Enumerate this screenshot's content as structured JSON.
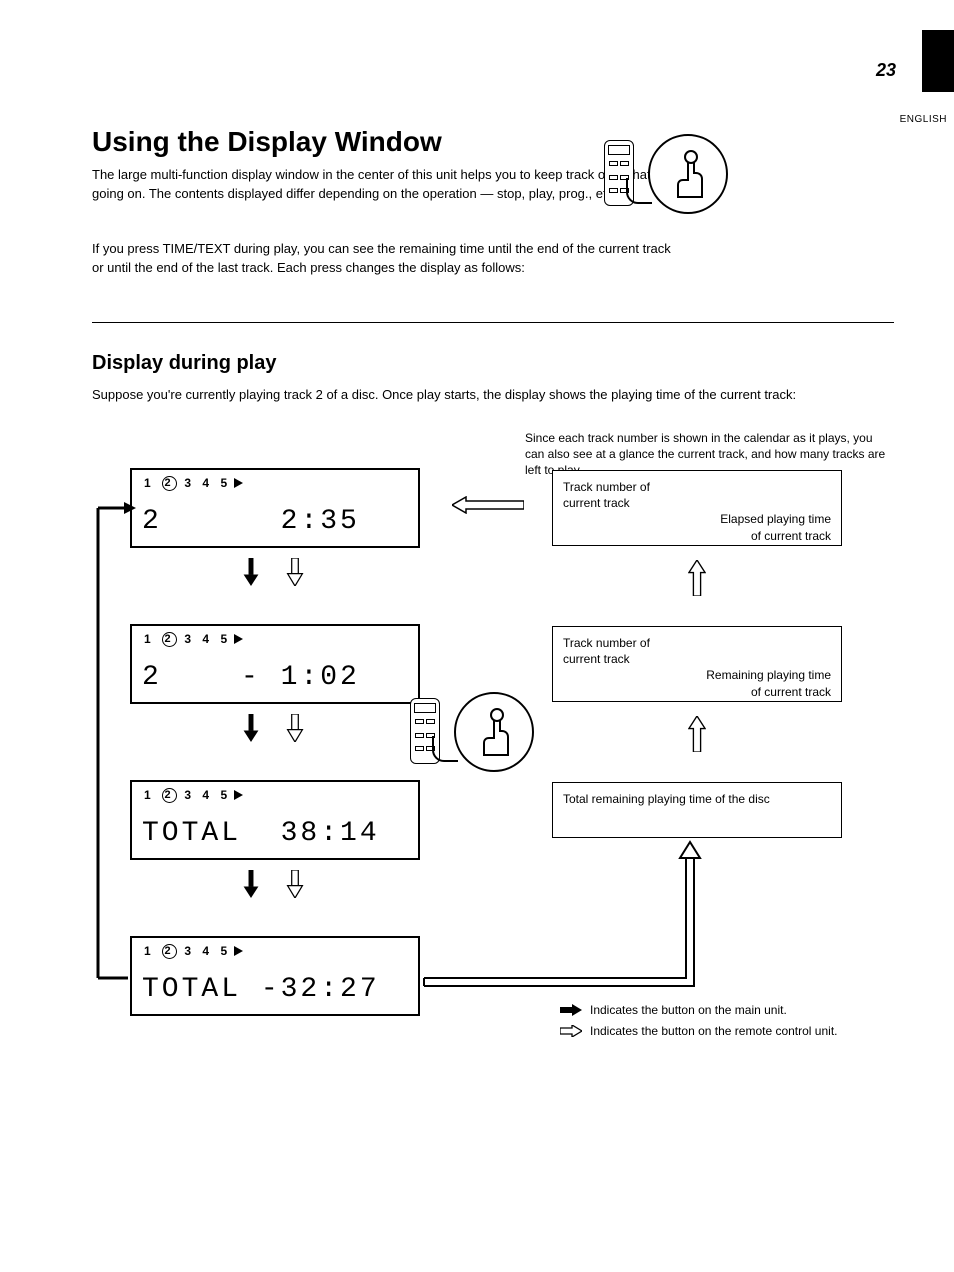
{
  "page_number": "23",
  "language_label": "ENGLISH",
  "heading1": "Using the Display Window",
  "paragraph1": "The large multi-function display window in the center of this unit helps you to keep track of all that's going on. The contents displayed differ depending on the operation — stop, play, prog., etc.",
  "paragraph2": "If you press TIME/TEXT during play, you can see the remaining time until the end of the current track or until the end of the last track. Each press changes the display as follows:",
  "heading2": "Display during play",
  "intro": "Suppose you're currently playing track 2 of a disc. Once play starts, the display shows the playing time of the current track:",
  "note_right": "Since each track number is shown in the calendar as it plays, you can also see at a glance the current track, and how many tracks are left to play.",
  "lcd_numbers": "1 2 3 4 5",
  "lcd1": {
    "left": "2",
    "right": "2:35"
  },
  "lcd2": {
    "left": "2",
    "right": "- 1:02"
  },
  "lcd3": {
    "left": "TOTAL",
    "right": "38:14"
  },
  "lcd4": {
    "left": "TOTAL",
    "right": "-32:27"
  },
  "info1": {
    "l1": "Track number of",
    "l2": "current track",
    "l3": "Elapsed playing time",
    "l4": "of current track"
  },
  "info2": {
    "l1": "Track number of",
    "l2": "current track",
    "l3": "Remaining playing time",
    "l4": "of current track"
  },
  "info3": {
    "l1": "Total remaining playing time of the disc"
  },
  "legend": {
    "solid": "Indicates the button on the main unit.",
    "open": "Indicates the button on the remote control unit."
  }
}
